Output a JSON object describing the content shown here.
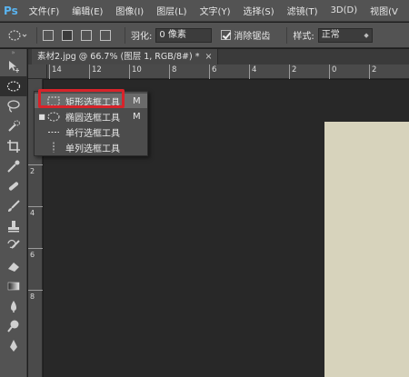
{
  "app": {
    "logo": "Ps"
  },
  "menu": {
    "items": [
      "文件(F)",
      "编辑(E)",
      "图像(I)",
      "图层(L)",
      "文字(Y)",
      "选择(S)",
      "滤镜(T)",
      "3D(D)",
      "视图(V"
    ]
  },
  "options": {
    "feather_label": "羽化:",
    "feather_value": "0 像素",
    "antialias_label": "消除锯齿",
    "antialias_checked": true,
    "style_label": "样式:",
    "style_value": "正常"
  },
  "document": {
    "tab_title": "素材2.jpg @ 66.7% (图层 1, RGB/8#) *",
    "close": "×"
  },
  "ruler": {
    "h_labels": [
      "14",
      "12",
      "10",
      "8",
      "6",
      "4",
      "2",
      "0",
      "2"
    ],
    "v_labels": [
      "2",
      "4",
      "6",
      "8"
    ]
  },
  "flyout": {
    "items": [
      {
        "label": "矩形选框工具",
        "shortcut": "M",
        "icon": "rect-marquee-icon",
        "current": false,
        "highlighted": true
      },
      {
        "label": "椭圆选框工具",
        "shortcut": "M",
        "icon": "ellipse-marquee-icon",
        "current": true,
        "highlighted": false
      },
      {
        "label": "单行选框工具",
        "shortcut": "",
        "icon": "single-row-marquee-icon",
        "current": false,
        "highlighted": false
      },
      {
        "label": "单列选框工具",
        "shortcut": "",
        "icon": "single-column-marquee-icon",
        "current": false,
        "highlighted": false
      }
    ]
  },
  "toolbar": {
    "tools": [
      "move-icon",
      "ellipse-marquee-icon",
      "lasso-icon",
      "quick-select-icon",
      "crop-icon",
      "eyedropper-icon",
      "healing-brush-icon",
      "brush-icon",
      "clone-stamp-icon",
      "history-brush-icon",
      "eraser-icon",
      "gradient-icon",
      "blur-icon",
      "dodge-icon",
      "pen-icon"
    ]
  },
  "colors": {
    "highlight_red": "#d8232a",
    "canvas_fill": "#d7d3bc",
    "ui_bg": "#535353"
  }
}
